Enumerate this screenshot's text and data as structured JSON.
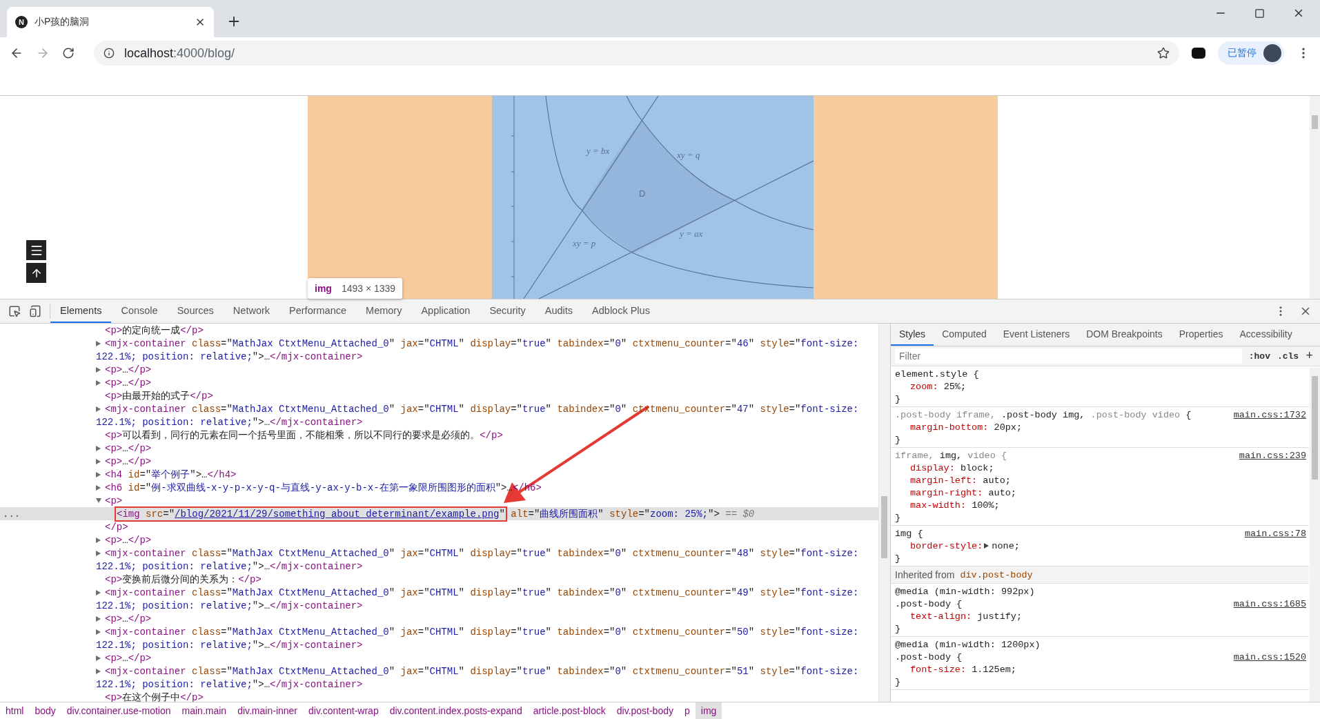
{
  "browser": {
    "tab": {
      "favicon": "N",
      "title": "小P孩的脑洞",
      "selected": true
    },
    "address": {
      "host": "localhost",
      "path": ":4000/blog/"
    },
    "profile_button": "已暂停"
  },
  "page": {
    "figure": {
      "labels": [
        {
          "text": "y = bx"
        },
        {
          "text": "xy = q"
        },
        {
          "text": "D"
        },
        {
          "text": "y = ax"
        },
        {
          "text": "xy = p"
        }
      ]
    },
    "tooltip": {
      "tag": "img",
      "size": "1493 × 1339"
    }
  },
  "devtools": {
    "tabs": [
      {
        "label": "Elements",
        "selected": true
      },
      {
        "label": "Console",
        "selected": false
      },
      {
        "label": "Sources",
        "selected": false
      },
      {
        "label": "Network",
        "selected": false
      },
      {
        "label": "Performance",
        "selected": false
      },
      {
        "label": "Memory",
        "selected": false
      },
      {
        "label": "Application",
        "selected": false
      },
      {
        "label": "Security",
        "selected": false
      },
      {
        "label": "Audits",
        "selected": false
      },
      {
        "label": "Adblock Plus",
        "selected": false
      }
    ],
    "elements": {
      "nodes": [
        {
          "expandable": false,
          "selected": false,
          "tokens": [
            {
              "kind": "tag",
              "text": "<p>"
            },
            {
              "kind": "text",
              "text": "的定向统一成"
            },
            {
              "kind": "tag",
              "text": "</p>"
            }
          ]
        },
        {
          "expandable": true,
          "expanded": false,
          "selected": false,
          "tokens": [
            {
              "kind": "tag",
              "text": "<mjx-container "
            },
            {
              "kind": "attr",
              "text": "class"
            },
            {
              "kind": "text",
              "text": "=\""
            },
            {
              "kind": "value",
              "text": "MathJax CtxtMenu_Attached_0"
            },
            {
              "kind": "text",
              "text": "\" "
            },
            {
              "kind": "attr",
              "text": "jax"
            },
            {
              "kind": "text",
              "text": "=\""
            },
            {
              "kind": "value",
              "text": "CHTML"
            },
            {
              "kind": "text",
              "text": "\" "
            },
            {
              "kind": "attr",
              "text": "display"
            },
            {
              "kind": "text",
              "text": "=\""
            },
            {
              "kind": "value",
              "text": "true"
            },
            {
              "kind": "text",
              "text": "\" "
            },
            {
              "kind": "attr",
              "text": "tabindex"
            },
            {
              "kind": "text",
              "text": "=\""
            },
            {
              "kind": "value",
              "text": "0"
            },
            {
              "kind": "text",
              "text": "\" "
            },
            {
              "kind": "attr",
              "text": "ctxtmenu_counter"
            },
            {
              "kind": "text",
              "text": "=\""
            },
            {
              "kind": "value",
              "text": "46"
            },
            {
              "kind": "text",
              "text": "\" "
            },
            {
              "kind": "attr",
              "text": "style"
            },
            {
              "kind": "text",
              "text": "=\""
            },
            {
              "kind": "value",
              "text": "font-size:"
            }
          ],
          "wrap": [
            {
              "kind": "value",
              "text": "122.1%; position: relative;"
            },
            {
              "kind": "text",
              "text": "\">…"
            },
            {
              "kind": "tag",
              "text": "</mjx-container>"
            }
          ]
        },
        {
          "expandable": true,
          "expanded": false,
          "selected": false,
          "tokens": [
            {
              "kind": "tag",
              "text": "<p>"
            },
            {
              "kind": "text",
              "text": "…"
            },
            {
              "kind": "tag",
              "text": "</p>"
            }
          ]
        },
        {
          "expandable": true,
          "expanded": false,
          "selected": false,
          "tokens": [
            {
              "kind": "tag",
              "text": "<p>"
            },
            {
              "kind": "text",
              "text": "…"
            },
            {
              "kind": "tag",
              "text": "</p>"
            }
          ]
        },
        {
          "expandable": false,
          "selected": false,
          "tokens": [
            {
              "kind": "tag",
              "text": "<p>"
            },
            {
              "kind": "text",
              "text": "由最开始的式子"
            },
            {
              "kind": "tag",
              "text": "</p>"
            }
          ]
        },
        {
          "expandable": true,
          "expanded": false,
          "selected": false,
          "tokens": [
            {
              "kind": "tag",
              "text": "<mjx-container "
            },
            {
              "kind": "attr",
              "text": "class"
            },
            {
              "kind": "text",
              "text": "=\""
            },
            {
              "kind": "value",
              "text": "MathJax CtxtMenu_Attached_0"
            },
            {
              "kind": "text",
              "text": "\" "
            },
            {
              "kind": "attr",
              "text": "jax"
            },
            {
              "kind": "text",
              "text": "=\""
            },
            {
              "kind": "value",
              "text": "CHTML"
            },
            {
              "kind": "text",
              "text": "\" "
            },
            {
              "kind": "attr",
              "text": "display"
            },
            {
              "kind": "text",
              "text": "=\""
            },
            {
              "kind": "value",
              "text": "true"
            },
            {
              "kind": "text",
              "text": "\" "
            },
            {
              "kind": "attr",
              "text": "tabindex"
            },
            {
              "kind": "text",
              "text": "=\""
            },
            {
              "kind": "value",
              "text": "0"
            },
            {
              "kind": "text",
              "text": "\" "
            },
            {
              "kind": "attr",
              "text": "ctxtmenu_counter"
            },
            {
              "kind": "text",
              "text": "=\""
            },
            {
              "kind": "value",
              "text": "47"
            },
            {
              "kind": "text",
              "text": "\" "
            },
            {
              "kind": "attr",
              "text": "style"
            },
            {
              "kind": "text",
              "text": "=\""
            },
            {
              "kind": "value",
              "text": "font-size:"
            }
          ],
          "wrap": [
            {
              "kind": "value",
              "text": "122.1%; position: relative;"
            },
            {
              "kind": "text",
              "text": "\">…"
            },
            {
              "kind": "tag",
              "text": "</mjx-container>"
            }
          ]
        },
        {
          "expandable": false,
          "selected": false,
          "tokens": [
            {
              "kind": "tag",
              "text": "<p>"
            },
            {
              "kind": "text",
              "text": "可以看到，同行的元素在同一个括号里面，不能相乘，所以不同行的要求是必须的。"
            },
            {
              "kind": "tag",
              "text": "</p>"
            }
          ]
        },
        {
          "expandable": true,
          "expanded": false,
          "selected": false,
          "tokens": [
            {
              "kind": "tag",
              "text": "<p>"
            },
            {
              "kind": "text",
              "text": "…"
            },
            {
              "kind": "tag",
              "text": "</p>"
            }
          ]
        },
        {
          "expandable": true,
          "expanded": false,
          "selected": false,
          "tokens": [
            {
              "kind": "tag",
              "text": "<p>"
            },
            {
              "kind": "text",
              "text": "…"
            },
            {
              "kind": "tag",
              "text": "</p>"
            }
          ]
        },
        {
          "expandable": true,
          "expanded": false,
          "selected": false,
          "tokens": [
            {
              "kind": "tag",
              "text": "<h4 "
            },
            {
              "kind": "attr",
              "text": "id"
            },
            {
              "kind": "text",
              "text": "=\""
            },
            {
              "kind": "value",
              "text": "举个例子"
            },
            {
              "kind": "text",
              "text": "\">…"
            },
            {
              "kind": "tag",
              "text": "</h4>"
            }
          ]
        },
        {
          "expandable": true,
          "expanded": false,
          "selected": false,
          "tokens": [
            {
              "kind": "tag",
              "text": "<h6 "
            },
            {
              "kind": "attr",
              "text": "id"
            },
            {
              "kind": "text",
              "text": "=\""
            },
            {
              "kind": "value",
              "text": "例-求双曲线-x-y-p-x-y-q-与直线-y-ax-y-b-x-在第一象限所围图形的面积"
            },
            {
              "kind": "text",
              "text": "\">…"
            },
            {
              "kind": "tag",
              "text": "</h6>"
            }
          ]
        },
        {
          "expandable": true,
          "expanded": true,
          "selected": false,
          "tokens": [
            {
              "kind": "tag",
              "text": "<p>"
            }
          ],
          "closing": [
            {
              "kind": "tag",
              "text": "</p>"
            }
          ],
          "children": [
            {
              "expandable": false,
              "selected": true,
              "gutter": "...",
              "boxed_tokens": [
                {
                  "kind": "tag",
                  "text": "<img "
                },
                {
                  "kind": "attr",
                  "text": "src"
                },
                {
                  "kind": "text",
                  "text": "=\""
                },
                {
                  "kind": "link",
                  "text": "/blog/2021/11/29/something_about_determinant/example.png"
                },
                {
                  "kind": "text",
                  "text": "\""
                }
              ],
              "tokens": [
                {
                  "kind": "attr",
                  "text": " alt"
                },
                {
                  "kind": "text",
                  "text": "=\""
                },
                {
                  "kind": "value",
                  "text": "曲线所围面积"
                },
                {
                  "kind": "text",
                  "text": "\" "
                },
                {
                  "kind": "attr",
                  "text": "style"
                },
                {
                  "kind": "text",
                  "text": "=\""
                },
                {
                  "kind": "value",
                  "text": "zoom: 25%;"
                },
                {
                  "kind": "text",
                  "text": "\">"
                },
                {
                  "kind": "hint",
                  "text": " == $0"
                }
              ]
            }
          ]
        },
        {
          "expandable": true,
          "expanded": false,
          "selected": false,
          "tokens": [
            {
              "kind": "tag",
              "text": "<p>"
            },
            {
              "kind": "text",
              "text": "…"
            },
            {
              "kind": "tag",
              "text": "</p>"
            }
          ]
        },
        {
          "expandable": true,
          "expanded": false,
          "selected": false,
          "tokens": [
            {
              "kind": "tag",
              "text": "<mjx-container "
            },
            {
              "kind": "attr",
              "text": "class"
            },
            {
              "kind": "text",
              "text": "=\""
            },
            {
              "kind": "value",
              "text": "MathJax CtxtMenu_Attached_0"
            },
            {
              "kind": "text",
              "text": "\" "
            },
            {
              "kind": "attr",
              "text": "jax"
            },
            {
              "kind": "text",
              "text": "=\""
            },
            {
              "kind": "value",
              "text": "CHTML"
            },
            {
              "kind": "text",
              "text": "\" "
            },
            {
              "kind": "attr",
              "text": "display"
            },
            {
              "kind": "text",
              "text": "=\""
            },
            {
              "kind": "value",
              "text": "true"
            },
            {
              "kind": "text",
              "text": "\" "
            },
            {
              "kind": "attr",
              "text": "tabindex"
            },
            {
              "kind": "text",
              "text": "=\""
            },
            {
              "kind": "value",
              "text": "0"
            },
            {
              "kind": "text",
              "text": "\" "
            },
            {
              "kind": "attr",
              "text": "ctxtmenu_counter"
            },
            {
              "kind": "text",
              "text": "=\""
            },
            {
              "kind": "value",
              "text": "48"
            },
            {
              "kind": "text",
              "text": "\" "
            },
            {
              "kind": "attr",
              "text": "style"
            },
            {
              "kind": "text",
              "text": "=\""
            },
            {
              "kind": "value",
              "text": "font-size:"
            }
          ],
          "wrap": [
            {
              "kind": "value",
              "text": "122.1%; position: relative;"
            },
            {
              "kind": "text",
              "text": "\">…"
            },
            {
              "kind": "tag",
              "text": "</mjx-container>"
            }
          ]
        },
        {
          "expandable": false,
          "selected": false,
          "tokens": [
            {
              "kind": "tag",
              "text": "<p>"
            },
            {
              "kind": "text",
              "text": "变换前后微分间的关系为："
            },
            {
              "kind": "tag",
              "text": "</p>"
            }
          ]
        },
        {
          "expandable": true,
          "expanded": false,
          "selected": false,
          "tokens": [
            {
              "kind": "tag",
              "text": "<mjx-container "
            },
            {
              "kind": "attr",
              "text": "class"
            },
            {
              "kind": "text",
              "text": "=\""
            },
            {
              "kind": "value",
              "text": "MathJax CtxtMenu_Attached_0"
            },
            {
              "kind": "text",
              "text": "\" "
            },
            {
              "kind": "attr",
              "text": "jax"
            },
            {
              "kind": "text",
              "text": "=\""
            },
            {
              "kind": "value",
              "text": "CHTML"
            },
            {
              "kind": "text",
              "text": "\" "
            },
            {
              "kind": "attr",
              "text": "display"
            },
            {
              "kind": "text",
              "text": "=\""
            },
            {
              "kind": "value",
              "text": "true"
            },
            {
              "kind": "text",
              "text": "\" "
            },
            {
              "kind": "attr",
              "text": "tabindex"
            },
            {
              "kind": "text",
              "text": "=\""
            },
            {
              "kind": "value",
              "text": "0"
            },
            {
              "kind": "text",
              "text": "\" "
            },
            {
              "kind": "attr",
              "text": "ctxtmenu_counter"
            },
            {
              "kind": "text",
              "text": "=\""
            },
            {
              "kind": "value",
              "text": "49"
            },
            {
              "kind": "text",
              "text": "\" "
            },
            {
              "kind": "attr",
              "text": "style"
            },
            {
              "kind": "text",
              "text": "=\""
            },
            {
              "kind": "value",
              "text": "font-size:"
            }
          ],
          "wrap": [
            {
              "kind": "value",
              "text": "122.1%; position: relative;"
            },
            {
              "kind": "text",
              "text": "\">…"
            },
            {
              "kind": "tag",
              "text": "</mjx-container>"
            }
          ]
        },
        {
          "expandable": true,
          "expanded": false,
          "selected": false,
          "tokens": [
            {
              "kind": "tag",
              "text": "<p>"
            },
            {
              "kind": "text",
              "text": "…"
            },
            {
              "kind": "tag",
              "text": "</p>"
            }
          ]
        },
        {
          "expandable": true,
          "expanded": false,
          "selected": false,
          "tokens": [
            {
              "kind": "tag",
              "text": "<mjx-container "
            },
            {
              "kind": "attr",
              "text": "class"
            },
            {
              "kind": "text",
              "text": "=\""
            },
            {
              "kind": "value",
              "text": "MathJax CtxtMenu_Attached_0"
            },
            {
              "kind": "text",
              "text": "\" "
            },
            {
              "kind": "attr",
              "text": "jax"
            },
            {
              "kind": "text",
              "text": "=\""
            },
            {
              "kind": "value",
              "text": "CHTML"
            },
            {
              "kind": "text",
              "text": "\" "
            },
            {
              "kind": "attr",
              "text": "display"
            },
            {
              "kind": "text",
              "text": "=\""
            },
            {
              "kind": "value",
              "text": "true"
            },
            {
              "kind": "text",
              "text": "\" "
            },
            {
              "kind": "attr",
              "text": "tabindex"
            },
            {
              "kind": "text",
              "text": "=\""
            },
            {
              "kind": "value",
              "text": "0"
            },
            {
              "kind": "text",
              "text": "\" "
            },
            {
              "kind": "attr",
              "text": "ctxtmenu_counter"
            },
            {
              "kind": "text",
              "text": "=\""
            },
            {
              "kind": "value",
              "text": "50"
            },
            {
              "kind": "text",
              "text": "\" "
            },
            {
              "kind": "attr",
              "text": "style"
            },
            {
              "kind": "text",
              "text": "=\""
            },
            {
              "kind": "value",
              "text": "font-size:"
            }
          ],
          "wrap": [
            {
              "kind": "value",
              "text": "122.1%; position: relative;"
            },
            {
              "kind": "text",
              "text": "\">…"
            },
            {
              "kind": "tag",
              "text": "</mjx-container>"
            }
          ]
        },
        {
          "expandable": true,
          "expanded": false,
          "selected": false,
          "tokens": [
            {
              "kind": "tag",
              "text": "<p>"
            },
            {
              "kind": "text",
              "text": "…"
            },
            {
              "kind": "tag",
              "text": "</p>"
            }
          ]
        },
        {
          "expandable": true,
          "expanded": false,
          "selected": false,
          "tokens": [
            {
              "kind": "tag",
              "text": "<mjx-container "
            },
            {
              "kind": "attr",
              "text": "class"
            },
            {
              "kind": "text",
              "text": "=\""
            },
            {
              "kind": "value",
              "text": "MathJax CtxtMenu_Attached_0"
            },
            {
              "kind": "text",
              "text": "\" "
            },
            {
              "kind": "attr",
              "text": "jax"
            },
            {
              "kind": "text",
              "text": "=\""
            },
            {
              "kind": "value",
              "text": "CHTML"
            },
            {
              "kind": "text",
              "text": "\" "
            },
            {
              "kind": "attr",
              "text": "display"
            },
            {
              "kind": "text",
              "text": "=\""
            },
            {
              "kind": "value",
              "text": "true"
            },
            {
              "kind": "text",
              "text": "\" "
            },
            {
              "kind": "attr",
              "text": "tabindex"
            },
            {
              "kind": "text",
              "text": "=\""
            },
            {
              "kind": "value",
              "text": "0"
            },
            {
              "kind": "text",
              "text": "\" "
            },
            {
              "kind": "attr",
              "text": "ctxtmenu_counter"
            },
            {
              "kind": "text",
              "text": "=\""
            },
            {
              "kind": "value",
              "text": "51"
            },
            {
              "kind": "text",
              "text": "\" "
            },
            {
              "kind": "attr",
              "text": "style"
            },
            {
              "kind": "text",
              "text": "=\""
            },
            {
              "kind": "value",
              "text": "font-size:"
            }
          ],
          "wrap": [
            {
              "kind": "value",
              "text": "122.1%; position: relative;"
            },
            {
              "kind": "text",
              "text": "\">…"
            },
            {
              "kind": "tag",
              "text": "</mjx-container>"
            }
          ]
        },
        {
          "expandable": false,
          "selected": false,
          "tokens": [
            {
              "kind": "tag",
              "text": "<p>"
            },
            {
              "kind": "text",
              "text": "在这个例子中"
            },
            {
              "kind": "tag",
              "text": "</p>"
            }
          ]
        }
      ]
    },
    "styles": {
      "tabs": [
        {
          "label": "Styles",
          "selected": true
        },
        {
          "label": "Computed",
          "selected": false
        },
        {
          "label": "Event Listeners",
          "selected": false
        },
        {
          "label": "DOM Breakpoints",
          "selected": false
        },
        {
          "label": "Properties",
          "selected": false
        },
        {
          "label": "Accessibility",
          "selected": false
        }
      ],
      "filter": {
        "placeholder": "Filter"
      },
      "hov": ":hov",
      "cls": ".cls",
      "add": "+",
      "rules": [
        {
          "kind": "rule",
          "selector": [
            {
              "text": "element.style {",
              "matched": true
            }
          ],
          "declarations": [
            {
              "property": "zoom:",
              "value": "25%;",
              "expandable": false
            }
          ],
          "closing": "}"
        },
        {
          "kind": "rule",
          "selector": [
            {
              "text": ".post-body iframe, ",
              "matched": false
            },
            {
              "text": ".post-body img,",
              "matched": true
            },
            {
              "text": " .post-body video",
              "matched": false
            },
            {
              "text": " {",
              "matched": true
            }
          ],
          "source": "main.css:1732",
          "declarations": [
            {
              "property": "margin-bottom:",
              "value": "20px;",
              "expandable": false
            }
          ],
          "closing": "}"
        },
        {
          "kind": "rule",
          "selector": [
            {
              "text": "iframe, ",
              "matched": false
            },
            {
              "text": "img,",
              "matched": true
            },
            {
              "text": " video {",
              "matched": false
            }
          ],
          "source": "main.css:239",
          "declarations": [
            {
              "property": "display:",
              "value": "block;",
              "expandable": false
            },
            {
              "property": "margin-left:",
              "value": "auto;",
              "expandable": false
            },
            {
              "property": "margin-right:",
              "value": "auto;",
              "expandable": false
            },
            {
              "property": "max-width:",
              "value": "100%;",
              "expandable": false
            }
          ],
          "closing": "}"
        },
        {
          "kind": "rule",
          "selector": [
            {
              "text": "img {",
              "matched": true
            }
          ],
          "source": "main.css:78",
          "declarations": [
            {
              "property": "border-style:",
              "value": "none;",
              "expandable": true
            }
          ],
          "closing": "}"
        },
        {
          "kind": "inherited",
          "label": "Inherited from",
          "source": "div.post-body"
        },
        {
          "kind": "rule",
          "media": "@media (min-width: 992px)",
          "selector": [
            {
              "text": ".post-body {",
              "matched": true
            }
          ],
          "source": "main.css:1685",
          "declarations": [
            {
              "property": "text-align:",
              "value": "justify;",
              "expandable": false
            }
          ],
          "closing": "}"
        },
        {
          "kind": "rule",
          "media": "@media (min-width: 1200px)",
          "selector": [
            {
              "text": ".post-body {",
              "matched": true
            }
          ],
          "source": "main.css:1520",
          "declarations": [
            {
              "property": "font-size:",
              "value": "1.125em;",
              "expandable": false
            }
          ],
          "closing": "}"
        }
      ]
    },
    "breadcrumbs": [
      {
        "label": "html",
        "selected": false
      },
      {
        "label": "body",
        "selected": false
      },
      {
        "label": "div.container.use-motion",
        "selected": false
      },
      {
        "label": "main.main",
        "selected": false
      },
      {
        "label": "div.main-inner",
        "selected": false
      },
      {
        "label": "div.content-wrap",
        "selected": false
      },
      {
        "label": "div.content.index.posts-expand",
        "selected": false
      },
      {
        "label": "article.post-block",
        "selected": false
      },
      {
        "label": "div.post-body",
        "selected": false
      },
      {
        "label": "p",
        "selected": false
      },
      {
        "label": "img",
        "selected": true
      }
    ]
  }
}
